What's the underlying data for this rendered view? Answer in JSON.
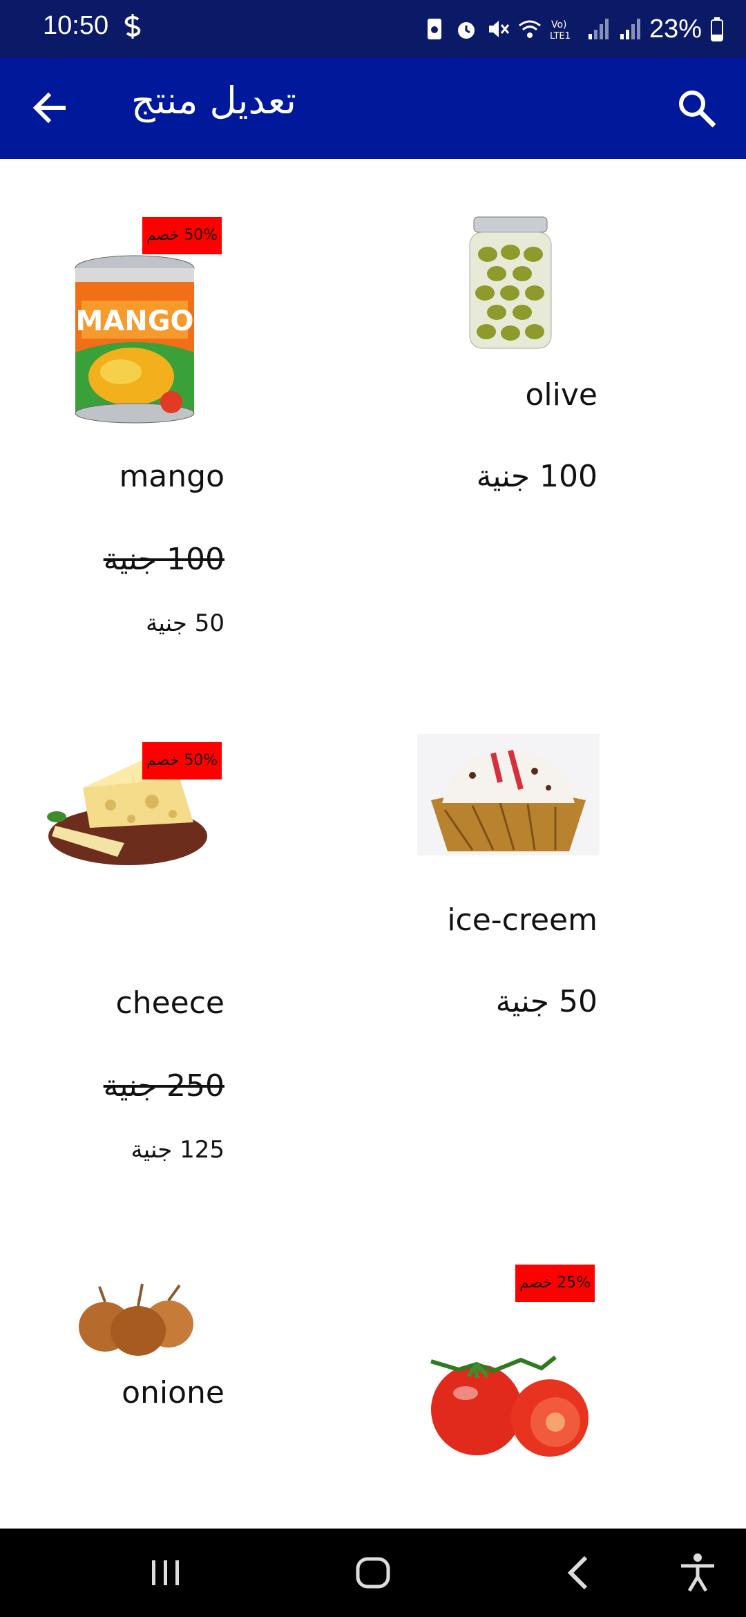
{
  "status_bar": {
    "time": "10:50",
    "battery": "23%"
  },
  "app_bar": {
    "title": "تعديل منتج"
  },
  "products": [
    {
      "name": "mango",
      "discount": "50% خصم",
      "old_price": "100 جنية",
      "new_price": "50 جنية"
    },
    {
      "name": "olive",
      "price": "100 جنية"
    },
    {
      "name": "cheece",
      "discount": "50% خصم",
      "old_price": "250 جنية",
      "new_price": "125 جنية"
    },
    {
      "name": "ice-creem",
      "price": "50 جنية"
    },
    {
      "name": "onione"
    },
    {
      "name": "tomato",
      "discount": "25% خصم"
    }
  ],
  "icons": {
    "status": [
      "battery-saver-icon",
      "alarm-icon",
      "mute-icon",
      "wifi-icon",
      "volte-icon",
      "signal-icon",
      "signal-icon-2",
      "battery-icon"
    ],
    "app_bar": [
      "back-arrow-icon",
      "search-icon"
    ],
    "nav": [
      "recents-icon",
      "home-icon",
      "back-icon",
      "accessibility-icon"
    ]
  },
  "colors": {
    "status_bar": "#0b1a66",
    "app_bar": "#00189a",
    "badge": "#ff0000"
  }
}
